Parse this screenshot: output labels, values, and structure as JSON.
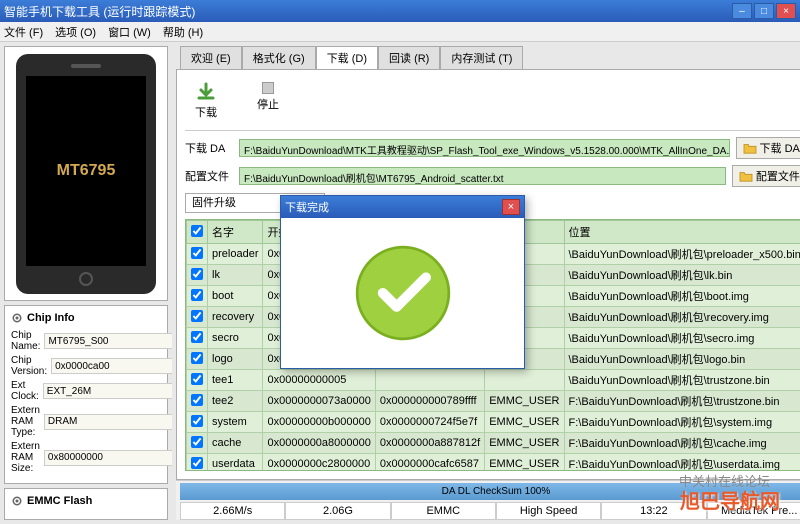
{
  "window": {
    "title": "智能手机下载工具 (运行时跟踪模式)"
  },
  "menu": {
    "file": "文件 (F)",
    "options": "选项 (O)",
    "window": "窗口 (W)",
    "help": "帮助 (H)"
  },
  "phone": {
    "model": "MT6795"
  },
  "chip": {
    "header": "Chip Info",
    "name_label": "Chip Name:",
    "name": "MT6795_S00",
    "ver_label": "Chip Version:",
    "ver": "0x0000ca00",
    "ext_label": "Ext Clock:",
    "ext": "EXT_26M",
    "ram_type_label": "Extern RAM Type:",
    "ram_type": "DRAM",
    "ram_size_label": "Extern RAM Size:",
    "ram_size": "0x80000000",
    "emmc": "EMMC Flash"
  },
  "tabs": {
    "welcome": "欢迎 (E)",
    "format": "格式化 (G)",
    "download": "下载 (D)",
    "readback": "回读 (R)",
    "memtest": "内存测试 (T)"
  },
  "actions": {
    "download": "下载",
    "stop": "停止"
  },
  "paths": {
    "da_label": "下载 DA",
    "da_value": "F:\\BaiduYunDownload\\MTK工具教程驱动\\SP_Flash_Tool_exe_Windows_v5.1528.00.000\\MTK_AllInOne_DA.bin",
    "da_btn": "下载 DA",
    "scatter_label": "配置文件",
    "scatter_value": "F:\\BaiduYunDownload\\刷机包\\MT6795_Android_scatter.txt",
    "scatter_btn": "配置文件"
  },
  "mode": "固件升级",
  "table": {
    "headers": {
      "chk": "",
      "name": "名字",
      "begin": "开始地址",
      "end": "",
      "region": "",
      "location": "位置"
    },
    "rows": [
      {
        "name": "preloader",
        "begin": "0x00000000000",
        "end": "",
        "region": "",
        "location": "\\BaiduYunDownload\\刷机包\\preloader_x500.bin"
      },
      {
        "name": "lk",
        "begin": "0x00000000000",
        "end": "",
        "region": "",
        "location": "\\BaiduYunDownload\\刷机包\\lk.bin"
      },
      {
        "name": "boot",
        "begin": "0x00000000001",
        "end": "",
        "region": "",
        "location": "\\BaiduYunDownload\\刷机包\\boot.img"
      },
      {
        "name": "recovery",
        "begin": "0x00000000002",
        "end": "",
        "region": "",
        "location": "\\BaiduYunDownload\\刷机包\\recovery.img"
      },
      {
        "name": "secro",
        "begin": "0x00000000003",
        "end": "",
        "region": "",
        "location": "\\BaiduYunDownload\\刷机包\\secro.img"
      },
      {
        "name": "logo",
        "begin": "0x00000000004",
        "end": "",
        "region": "",
        "location": "\\BaiduYunDownload\\刷机包\\logo.bin"
      },
      {
        "name": "tee1",
        "begin": "0x00000000005",
        "end": "",
        "region": "",
        "location": "\\BaiduYunDownload\\刷机包\\trustzone.bin"
      },
      {
        "name": "tee2",
        "begin": "0x0000000073a0000",
        "end": "0x000000000789ffff",
        "region": "EMMC_USER",
        "location": "F:\\BaiduYunDownload\\刷机包\\trustzone.bin"
      },
      {
        "name": "system",
        "begin": "0x00000000b000000",
        "end": "0x0000000724f5e7f",
        "region": "EMMC_USER",
        "location": "F:\\BaiduYunDownload\\刷机包\\system.img"
      },
      {
        "name": "cache",
        "begin": "0x0000000a8000000",
        "end": "0x0000000a887812f",
        "region": "EMMC_USER",
        "location": "F:\\BaiduYunDownload\\刷机包\\cache.img"
      },
      {
        "name": "userdata",
        "begin": "0x0000000c2800000",
        "end": "0x0000000cafc6587",
        "region": "EMMC_USER",
        "location": "F:\\BaiduYunDownload\\刷机包\\userdata.img"
      }
    ]
  },
  "status": {
    "progress": "DA DL CheckSum 100%",
    "speed": "2.66M/s",
    "size": "2.06G",
    "emmc": "EMMC",
    "hs": "High Speed",
    "time": "13:22",
    "chip": "MediaTek Pre..."
  },
  "modal": {
    "title": "下载完成"
  },
  "watermark": "旭巴导航网",
  "watermark2": "中关村在线论坛"
}
